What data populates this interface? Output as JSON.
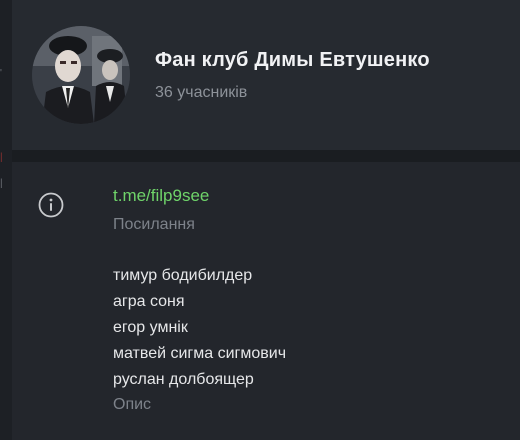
{
  "group": {
    "title": "Фан клуб Димы Евтушенко",
    "members": "36 учасників"
  },
  "info": {
    "link": "t.me/filp9see",
    "link_label": "Посилання",
    "description_lines": [
      "тимур бодибилдер",
      "агра соня",
      "егор умнік",
      "матвей сигма сигмович",
      "руслан долбоящер"
    ],
    "description_label": "Опис"
  },
  "icons": {
    "info": "info-circle-icon"
  },
  "colors": {
    "link": "#6fd46a",
    "background": "#23262c",
    "header_background": "#262a30"
  }
}
